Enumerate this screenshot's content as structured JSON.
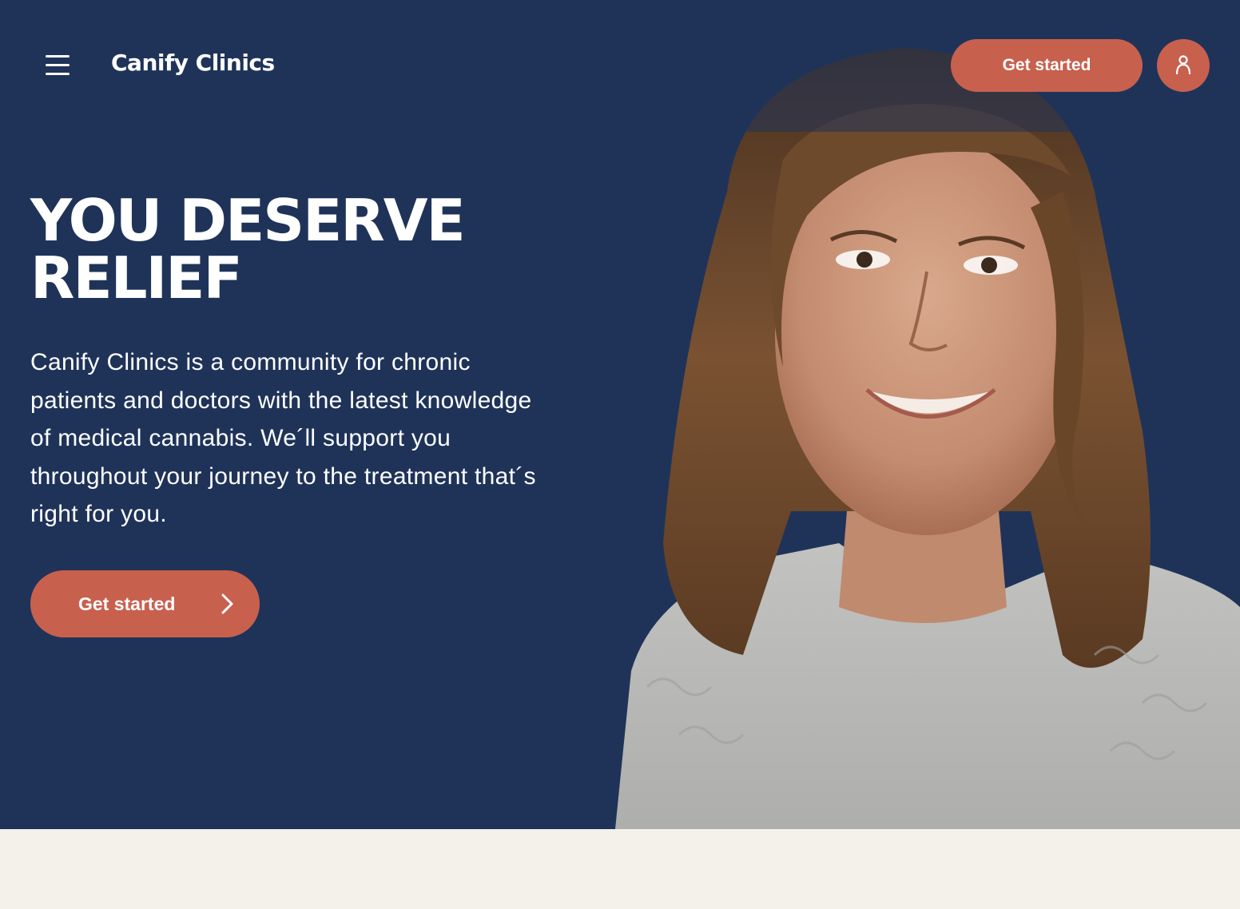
{
  "header": {
    "logo_text": "Canify Clinics",
    "menu_icon": "hamburger-menu-icon",
    "get_started_label": "Get started",
    "account_icon": "user-icon"
  },
  "hero": {
    "headline_line1": "YOU DESERVE",
    "headline_line2": "RELIEF",
    "description": "Canify Clinics is a community for chronic patients and doctors with the latest knowledge of medical cannabis. We´ll support you throughout your journey to the treatment that´s right for you.",
    "cta_label": "Get started",
    "cta_icon": "chevron-right-icon",
    "image_subject": "smiling-woman-portrait"
  },
  "colors": {
    "hero_background": "#1f3359",
    "accent": "#c8604e",
    "text_light": "#ffffff",
    "page_background": "#f4f0ea"
  }
}
